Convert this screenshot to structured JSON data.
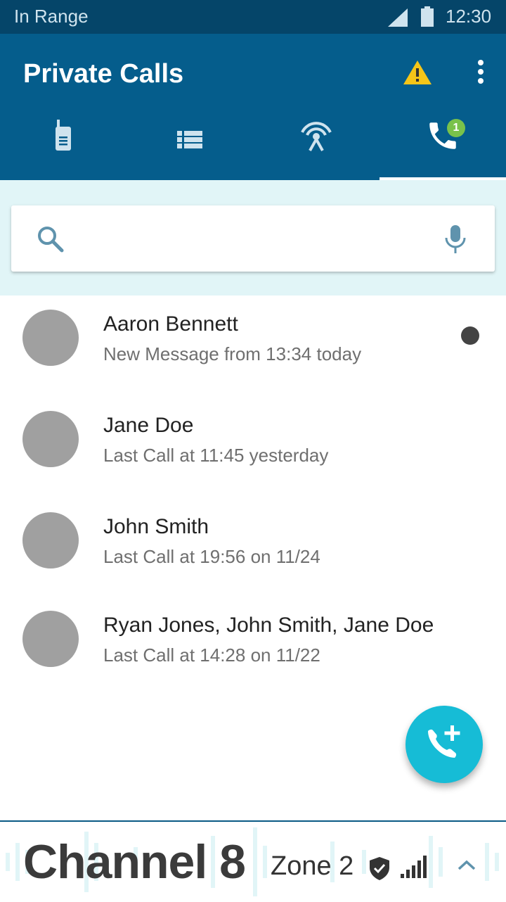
{
  "status_bar": {
    "status": "In Range",
    "time": "12:30"
  },
  "app_bar": {
    "title": "Private Calls"
  },
  "tabs": [
    {
      "icon": "radio-icon",
      "selected": false
    },
    {
      "icon": "list-icon",
      "selected": false
    },
    {
      "icon": "broadcast-icon",
      "selected": false
    },
    {
      "icon": "phone-icon",
      "selected": true,
      "badge": "1"
    }
  ],
  "search": {
    "value": "",
    "placeholder": ""
  },
  "contacts": [
    {
      "name": "Aaron Bennett",
      "subtitle": "New Message from 13:34 today",
      "unread": true
    },
    {
      "name": "Jane Doe",
      "subtitle": "Last Call at 11:45 yesterday",
      "unread": false
    },
    {
      "name": "John Smith",
      "subtitle": "Last Call at 19:56 on 11/24",
      "unread": false
    },
    {
      "name": "Ryan Jones, John Smith, Jane Doe",
      "subtitle": "Last Call at 14:28 on 11/22",
      "unread": false
    }
  ],
  "fab": {
    "icon": "add-call-icon"
  },
  "bottom_bar": {
    "channel": "Channel 8",
    "zone": "Zone 2"
  },
  "colors": {
    "status_bar": "#054569",
    "app_bar": "#055d8c",
    "search_zone": "#e1f5f7",
    "fab": "#16bcd6",
    "badge": "#79c24b",
    "warning": "#f5c518"
  }
}
